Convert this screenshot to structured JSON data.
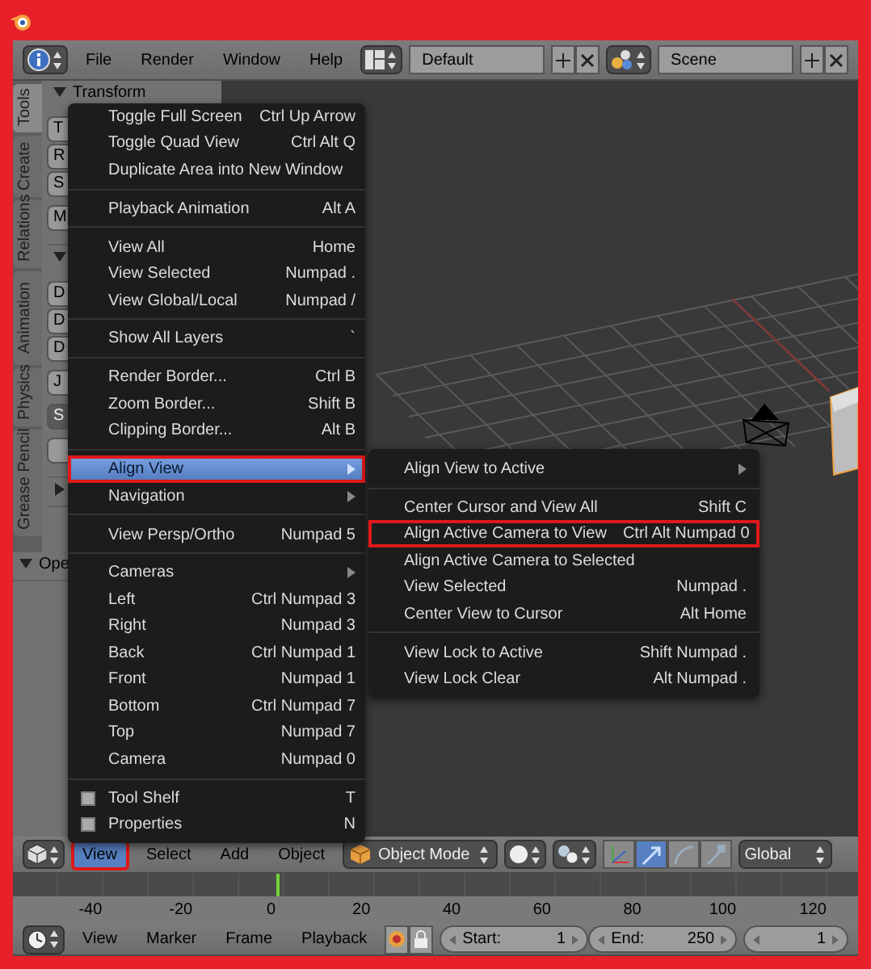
{
  "top_bar": {
    "menus": [
      "File",
      "Render",
      "Window",
      "Help"
    ],
    "screen_layout": "Default",
    "scene": "Scene"
  },
  "tool_shelf": {
    "tabs": [
      {
        "label": "Tools",
        "selected": true
      },
      {
        "label": "Create",
        "selected": false
      },
      {
        "label": "Relations",
        "selected": false
      },
      {
        "label": "Animation",
        "selected": false
      },
      {
        "label": "Physics",
        "selected": false
      },
      {
        "label": "Grease Pencil",
        "selected": false
      }
    ],
    "panels": [
      {
        "title": "Transform",
        "expanded": true,
        "groups": [
          [
            {
              "kind": "button",
              "label": "T"
            },
            {
              "kind": "button",
              "label": "R"
            },
            {
              "kind": "button",
              "label": "S"
            }
          ],
          [
            {
              "kind": "button",
              "label": "M"
            }
          ]
        ]
      },
      {
        "expanded": true,
        "groups": [
          [
            {
              "kind": "button",
              "label": "D"
            },
            {
              "kind": "button",
              "label": "D"
            },
            {
              "kind": "button",
              "label": "D"
            }
          ],
          [
            {
              "kind": "button",
              "label": "J"
            }
          ],
          [
            {
              "kind": "dropdown",
              "label": "S"
            }
          ],
          [
            {
              "kind": "button"
            }
          ]
        ]
      },
      {
        "expanded": false
      }
    ],
    "operator_panel": {
      "title": "Ope",
      "expanded": true
    }
  },
  "view_menu": {
    "items": [
      {
        "kind": "item",
        "label": "Toggle Full Screen",
        "shortcut": "Ctrl Up Arrow",
        "selected": false,
        "marked": false
      },
      {
        "kind": "item",
        "label": "Toggle Quad View",
        "shortcut": "Ctrl Alt Q",
        "selected": false,
        "marked": false
      },
      {
        "kind": "item",
        "label": "Duplicate Area into New Window",
        "selected": false,
        "marked": false
      },
      {
        "kind": "separator"
      },
      {
        "kind": "item",
        "label": "Playback Animation",
        "shortcut": "Alt A",
        "selected": false,
        "marked": false
      },
      {
        "kind": "separator"
      },
      {
        "kind": "item",
        "label": "View All",
        "shortcut": "Home",
        "selected": false,
        "marked": false
      },
      {
        "kind": "item",
        "label": "View Selected",
        "shortcut": "Numpad .",
        "selected": false,
        "marked": false
      },
      {
        "kind": "item",
        "label": "View Global/Local",
        "shortcut": "Numpad /",
        "selected": false,
        "marked": false
      },
      {
        "kind": "separator"
      },
      {
        "kind": "item",
        "label": "Show All Layers",
        "shortcut": "`",
        "selected": false,
        "marked": false
      },
      {
        "kind": "separator"
      },
      {
        "kind": "item",
        "label": "Render Border...",
        "shortcut": "Ctrl B",
        "selected": false,
        "marked": false
      },
      {
        "kind": "item",
        "label": "Zoom Border...",
        "shortcut": "Shift B",
        "selected": false,
        "marked": false
      },
      {
        "kind": "item",
        "label": "Clipping Border...",
        "shortcut": "Alt B",
        "selected": false,
        "marked": false
      },
      {
        "kind": "separator"
      },
      {
        "kind": "submenu",
        "label": "Align View",
        "selected": true,
        "marked": true
      },
      {
        "kind": "submenu",
        "label": "Navigation",
        "selected": false,
        "marked": false
      },
      {
        "kind": "separator"
      },
      {
        "kind": "item",
        "label": "View Persp/Ortho",
        "shortcut": "Numpad 5",
        "selected": false,
        "marked": false
      },
      {
        "kind": "separator"
      },
      {
        "kind": "submenu",
        "label": "Cameras",
        "selected": false,
        "marked": false
      },
      {
        "kind": "item",
        "label": "Left",
        "shortcut": "Ctrl Numpad 3",
        "selected": false,
        "marked": false
      },
      {
        "kind": "item",
        "label": "Right",
        "shortcut": "Numpad 3",
        "selected": false,
        "marked": false
      },
      {
        "kind": "item",
        "label": "Back",
        "shortcut": "Ctrl Numpad 1",
        "selected": false,
        "marked": false
      },
      {
        "kind": "item",
        "label": "Front",
        "shortcut": "Numpad 1",
        "selected": false,
        "marked": false
      },
      {
        "kind": "item",
        "label": "Bottom",
        "shortcut": "Ctrl Numpad 7",
        "selected": false,
        "marked": false
      },
      {
        "kind": "item",
        "label": "Top",
        "shortcut": "Numpad 7",
        "selected": false,
        "marked": false
      },
      {
        "kind": "item",
        "label": "Camera",
        "shortcut": "Numpad 0",
        "selected": false,
        "marked": false
      },
      {
        "kind": "separator"
      },
      {
        "kind": "check",
        "label": "Tool Shelf",
        "shortcut": "T",
        "checked": false,
        "selected": false,
        "marked": false
      },
      {
        "kind": "check",
        "label": "Properties",
        "shortcut": "N",
        "checked": false,
        "selected": false,
        "marked": false
      }
    ]
  },
  "align_view_submenu": {
    "items": [
      {
        "kind": "submenu",
        "label": "Align View to Active",
        "selected": false,
        "marked": false
      },
      {
        "kind": "separator"
      },
      {
        "kind": "item",
        "label": "Center Cursor and View All",
        "shortcut": "Shift C",
        "selected": false,
        "marked": false
      },
      {
        "kind": "item",
        "label": "Align Active Camera to View",
        "shortcut": "Ctrl Alt Numpad 0",
        "selected": false,
        "marked": true
      },
      {
        "kind": "item",
        "label": "Align Active Camera to Selected",
        "selected": false,
        "marked": false
      },
      {
        "kind": "item",
        "label": "View Selected",
        "shortcut": "Numpad .",
        "selected": false,
        "marked": false
      },
      {
        "kind": "item",
        "label": "Center View to Cursor",
        "shortcut": "Alt Home",
        "selected": false,
        "marked": false
      },
      {
        "kind": "separator"
      },
      {
        "kind": "item",
        "label": "View Lock to Active",
        "shortcut": "Shift Numpad .",
        "selected": false,
        "marked": false
      },
      {
        "kind": "item",
        "label": "View Lock Clear",
        "shortcut": "Alt Numpad .",
        "selected": false,
        "marked": false
      }
    ]
  },
  "viewport_header": {
    "menus": [
      {
        "label": "View",
        "selected": true,
        "marked": true
      },
      {
        "label": "Select",
        "selected": false,
        "marked": false
      },
      {
        "label": "Add",
        "selected": false,
        "marked": false
      },
      {
        "label": "Object",
        "selected": false,
        "marked": false
      }
    ],
    "mode": "Object Mode",
    "orientation": "Global",
    "transform_tools": [
      {
        "kind": "axes",
        "selected": false
      },
      {
        "kind": "translate",
        "selected": true
      },
      {
        "kind": "rotate",
        "selected": false
      },
      {
        "kind": "scale",
        "selected": false
      }
    ]
  },
  "timeline": {
    "ruler_labels": [
      "-40",
      "-20",
      "0",
      "20",
      "40",
      "60",
      "80",
      "100",
      "120"
    ]
  },
  "timeline_header": {
    "menus": [
      "View",
      "Marker",
      "Frame",
      "Playback"
    ],
    "start": {
      "label": "Start:",
      "value": "1"
    },
    "end": {
      "label": "End:",
      "value": "250"
    },
    "current_frame": "1"
  }
}
